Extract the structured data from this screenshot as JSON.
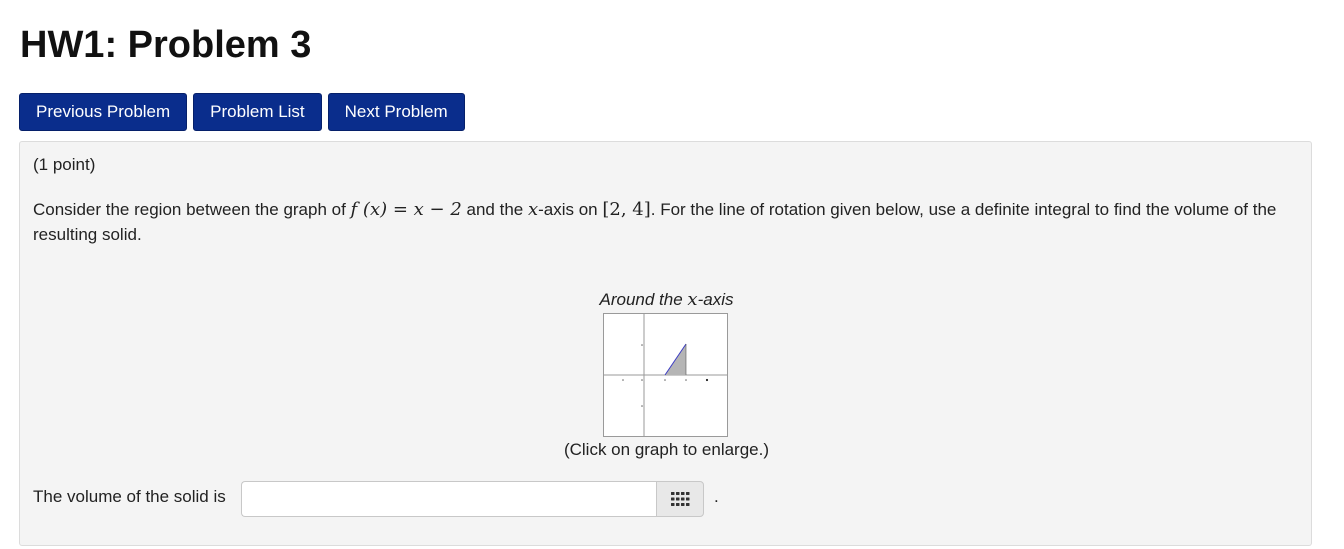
{
  "page": {
    "title": "HW1: Problem 3"
  },
  "nav": {
    "previous_label": "Previous Problem",
    "list_label": "Problem List",
    "next_label": "Next Problem"
  },
  "problem": {
    "points": "(1 point)",
    "statement": {
      "part1": "Consider the region between the graph of ",
      "fx": "f (x) = x − 2",
      "part2": " and the ",
      "axis_var": "x",
      "part3": "-axis on ",
      "interval": "[2, 4]",
      "part4": ". For the line of rotation given below, use a definite integral to find the volume of the resulting solid."
    },
    "figure": {
      "caption_prefix": "Around the ",
      "caption_var": "x",
      "caption_suffix": "-axis",
      "enlarge_note": "(Click on graph to enlarge.)",
      "region_fill": "#b5b5b5",
      "curve_color": "#3b3bc4"
    },
    "answer": {
      "label": "The volume of the solid is",
      "value": "",
      "trailing": "."
    }
  },
  "colors": {
    "nav_button_bg": "#0a2d8c",
    "panel_bg": "#f4f4f4"
  },
  "icons": {
    "palette": "grid-palette-icon"
  }
}
